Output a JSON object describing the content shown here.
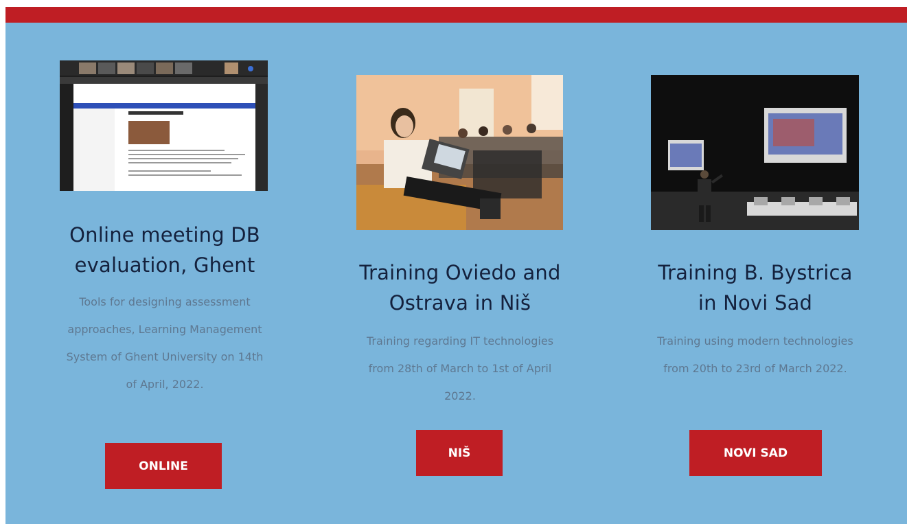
{
  "cards": [
    {
      "title": "Online meeting DB evaluation, Ghent",
      "description": "Tools for designing assessment approaches, Learning Management System of Ghent University on 14th of April, 2022.",
      "button": "ONLINE",
      "image_label": "screenshot of online meeting"
    },
    {
      "title": "Training Oviedo and Ostrava in Niš",
      "description": "Training regarding IT technologies from 28th of March to 1st of April 2022.",
      "button": "NIŠ",
      "image_label": "photo of training audience"
    },
    {
      "title": "Training B. Bystrica in Novi Sad",
      "description": "Training using modern technologies from 20th to 23rd of March 2022.",
      "button": "NOVI SAD",
      "image_label": "photo of lecture hall with projector screens"
    }
  ],
  "colors": {
    "accent": "#bf1e24",
    "panel": "#7ab5db",
    "title": "#14213d",
    "description": "#5e7891"
  }
}
